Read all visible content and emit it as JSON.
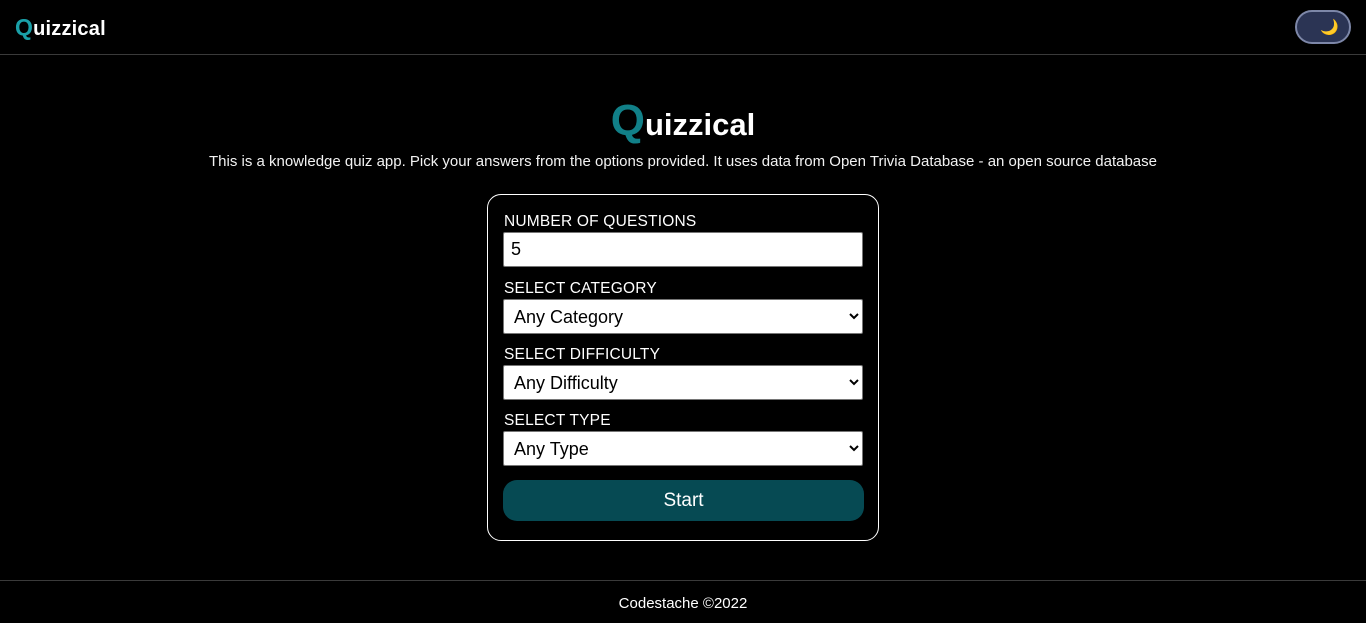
{
  "app": {
    "brand_initial": "Q",
    "brand_rest": "uizzical",
    "theme_toggle_icon": "moon-icon",
    "theme_toggle_glyph": "🌙"
  },
  "hero": {
    "title_initial": "Q",
    "title_rest": "uizzical",
    "description": "This is a knowledge quiz app. Pick your answers from the options provided. It uses data from Open Trivia Database - an open source database"
  },
  "form": {
    "questions_label": "NUMBER OF QUESTIONS",
    "questions_value": "5",
    "category_label": "SELECT CATEGORY",
    "category_selected": "Any Category",
    "difficulty_label": "SELECT DIFFICULTY",
    "difficulty_selected": "Any Difficulty",
    "type_label": "SELECT TYPE",
    "type_selected": "Any Type",
    "start_label": "Start"
  },
  "footer": {
    "text": "Codestache ©2022"
  },
  "colors": {
    "background": "#000000",
    "accent": "#1aa0a8",
    "button": "#064a53",
    "toggle_bg": "#2b3454"
  }
}
